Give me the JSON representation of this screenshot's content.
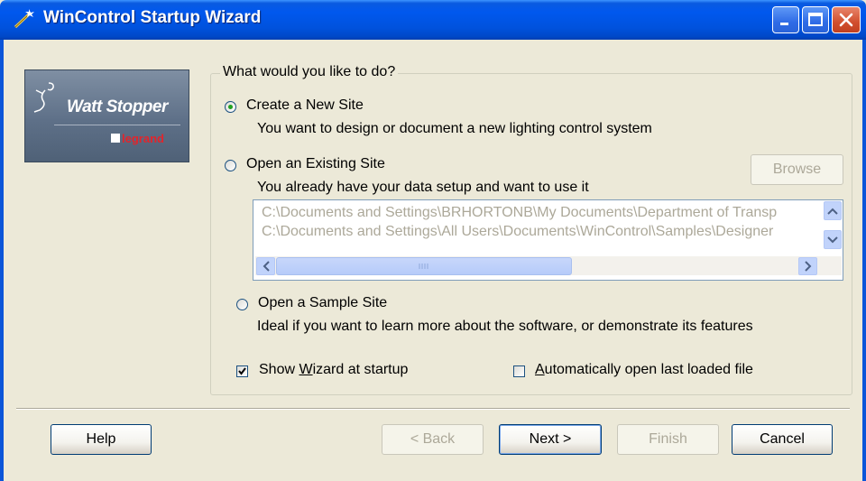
{
  "window": {
    "title": "WinControl Startup Wizard",
    "icons": [
      "app-wand-icon",
      "minimize-icon",
      "maximize-icon",
      "close-icon"
    ]
  },
  "logo": {
    "brand": "Watt Stopper",
    "sub": "legrand"
  },
  "group": {
    "legend": "What would you like to do?",
    "options": [
      {
        "label": "Create a New Site",
        "description": "You want to design or document a new lighting control system",
        "selected": true
      },
      {
        "label": "Open an Existing Site",
        "description": "You already have your data setup and want to use it",
        "selected": false
      },
      {
        "label": "Open a Sample Site",
        "description": "Ideal if you want to learn more about the software, or demonstrate its features",
        "selected": false
      }
    ],
    "browse_label": "Browse",
    "recent_files": [
      "C:\\Documents and Settings\\BRHORTONB\\My Documents\\Department of Transp",
      "C:\\Documents and Settings\\All Users\\Documents\\WinControl\\Samples\\Designer"
    ],
    "show_wizard": {
      "label_pre": "Show ",
      "label_u": "W",
      "label_post": "izard at startup",
      "checked": true
    },
    "auto_open": {
      "label_pre": "",
      "label_u": "A",
      "label_post": "utomatically open last loaded file",
      "checked": false
    }
  },
  "buttons": {
    "help": "Help",
    "back": "< Back",
    "next": "Next >",
    "finish": "Finish",
    "cancel": "Cancel"
  },
  "colors": {
    "titlebar": "#0058EE",
    "dialog_bg": "#ECE9D8",
    "disabled_text": "#ACA899",
    "radio_dot": "#21A121"
  }
}
